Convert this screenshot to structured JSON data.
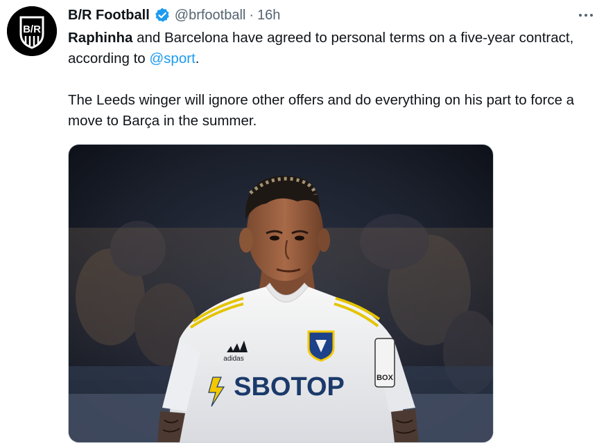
{
  "tweet": {
    "display_name": "B/R Football",
    "handle": "@brfootball",
    "separator": "·",
    "time": "16h",
    "paragraph1": {
      "bold": "Raphinha",
      "text_a": " and Barcelona have agreed to personal terms on a five-year contract, according to ",
      "mention": "@sport",
      "text_b": "."
    },
    "paragraph2": "The Leeds winger will ignore other offers and do everything on his part to force a move to Barça in the summer."
  },
  "avatar": {
    "logo_text": "B/R"
  },
  "media": {
    "shirt_sponsor": "SBOTOP",
    "kit_brand": "adidas",
    "sleeve_text": "BOX"
  },
  "colors": {
    "accent": "#1d9bf0",
    "text": "#0f1419",
    "secondary": "#536471"
  },
  "icons": {
    "verified": "verified-badge-icon",
    "more": "more-options-icon"
  }
}
